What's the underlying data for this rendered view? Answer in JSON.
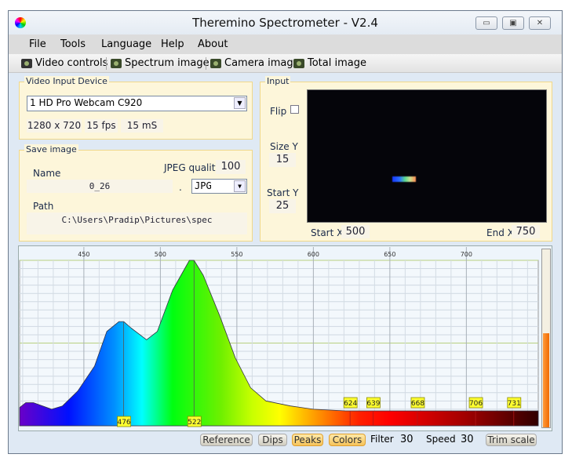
{
  "window": {
    "title": "Theremino Spectrometer - V2.4",
    "minimize": "▭",
    "maximize": "▣",
    "close": "✕"
  },
  "menu": [
    "File",
    "Tools",
    "Language",
    "Help",
    "About"
  ],
  "toolbar": [
    "Video controls",
    "Spectrum image",
    "Camera image",
    "Total image"
  ],
  "video_input": {
    "label": "Video Input Device",
    "device": "1 HD Pro Webcam C920",
    "resolution": "1280 x 720",
    "fps": "15 fps",
    "exposure": "15 mS"
  },
  "save_image": {
    "label": "Save image",
    "name_label": "Name",
    "name": "0_26",
    "dot": ".",
    "format": "JPG",
    "jpeg_quality_label": "JPEG quality",
    "jpeg_quality": "100",
    "path_label": "Path",
    "path": "C:\\Users\\Pradip\\Pictures\\spec"
  },
  "input": {
    "label": "Input",
    "flip_label": "Flip",
    "flip": false,
    "size_y_label": "Size Y",
    "size_y": "15",
    "start_y_label": "Start Y",
    "start_y": "25",
    "start_x_label": "Start X",
    "start_x": "500",
    "end_x_label": "End X",
    "end_x": "750"
  },
  "level_meter": 0.53,
  "chart_data": {
    "type": "area",
    "xlim": [
      408,
      747
    ],
    "ylim": [
      0,
      1
    ],
    "grid": true,
    "x_ticks": [
      "450",
      "500",
      "550",
      "600",
      "650",
      "700"
    ],
    "x": [
      408,
      412,
      417,
      429,
      436,
      446,
      457,
      465,
      473,
      476,
      481,
      491,
      498,
      508,
      519,
      522,
      528,
      539,
      549,
      559,
      569,
      585,
      600,
      621,
      652,
      678,
      703,
      728,
      747
    ],
    "y": [
      0.11,
      0.14,
      0.14,
      0.1,
      0.12,
      0.21,
      0.36,
      0.57,
      0.63,
      0.63,
      0.59,
      0.52,
      0.57,
      0.82,
      1.0,
      1.0,
      0.91,
      0.66,
      0.41,
      0.23,
      0.15,
      0.12,
      0.1,
      0.09,
      0.09,
      0.09,
      0.09,
      0.09,
      0.09
    ],
    "peaks": [
      "476",
      "522",
      "624",
      "639",
      "668",
      "706",
      "731"
    ]
  },
  "controls": {
    "reference": "Reference",
    "dips": "Dips",
    "peaks": "Peaks",
    "colors": "Colors",
    "filter_label": "Filter",
    "filter": "30",
    "speed_label": "Speed",
    "speed": "30",
    "trim_scale": "Trim scale"
  }
}
